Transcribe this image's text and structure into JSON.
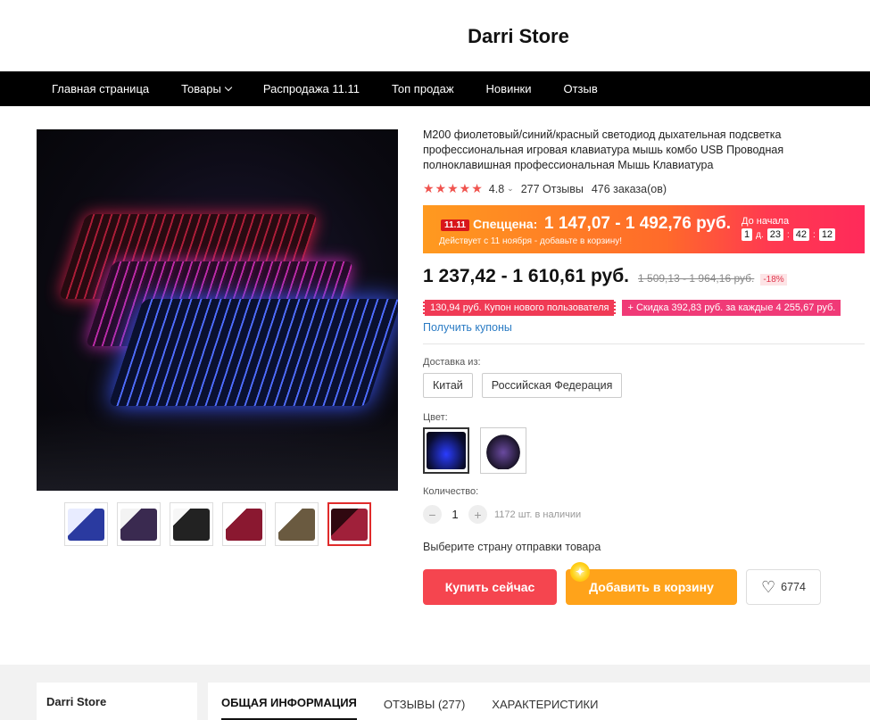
{
  "store": {
    "name": "Darri Store"
  },
  "nav": {
    "items": [
      {
        "label": "Главная страница"
      },
      {
        "label": "Товары",
        "has_dropdown": true
      },
      {
        "label": "Распродажа 11.11"
      },
      {
        "label": "Топ продаж"
      },
      {
        "label": "Новинки"
      },
      {
        "label": "Отзыв"
      }
    ]
  },
  "product": {
    "title": "M200 фиолетовый/синий/красный светодиод дыхательная подсветка профессиональная игровая клавиатура мышь комбо USB Проводная полноклавишная профессиональная Мышь Клавиатура",
    "rating": "4.8",
    "stars": "★★★★★",
    "reviews": "277 Отзывы",
    "orders": "476 заказа(ов)"
  },
  "promo": {
    "badge": "11.11",
    "label": "Спеццена:",
    "price": "1 147,07 - 1 492,76 руб.",
    "note": "Действует с 11 ноября - добавьте в корзину!",
    "countdown_label": "До начала",
    "countdown": {
      "days": "1",
      "days_unit": "д.",
      "hours": "23",
      "minutes": "42",
      "seconds": "12"
    }
  },
  "price": {
    "current": "1 237,42 - 1 610,61 руб.",
    "old": "1 509,13 - 1 964,16 руб.",
    "discount": "-18%"
  },
  "coupons": {
    "new_user": "130,94 руб. Купон нового пользователя",
    "discount": "+ Скидка 392,83 руб. за каждые 4 255,67 руб.",
    "get_link": "Получить купоны"
  },
  "shipping": {
    "label": "Доставка из:",
    "options": [
      "Китай",
      "Российская Федерация"
    ]
  },
  "color": {
    "label": "Цвет:"
  },
  "quantity": {
    "label": "Количество:",
    "value": "1",
    "minus": "−",
    "plus": "+",
    "stock": "1172 шт. в наличии"
  },
  "ship_country_prompt": "Выберите страну отправки товара",
  "actions": {
    "buy_now": "Купить сейчас",
    "add_to_cart": "Добавить в корзину",
    "wishlist_count": "6774"
  },
  "tabs": [
    {
      "label": "ОБЩАЯ ИНФОРМАЦИЯ",
      "active": true
    },
    {
      "label": "ОТЗЫВЫ (277)"
    },
    {
      "label": "ХАРАКТЕРИСТИКИ"
    }
  ],
  "colors": {
    "accent_red": "#f5454f",
    "accent_orange": "#ffa31a",
    "link_blue": "#2a7bc4",
    "nav_bg": "#000000"
  }
}
